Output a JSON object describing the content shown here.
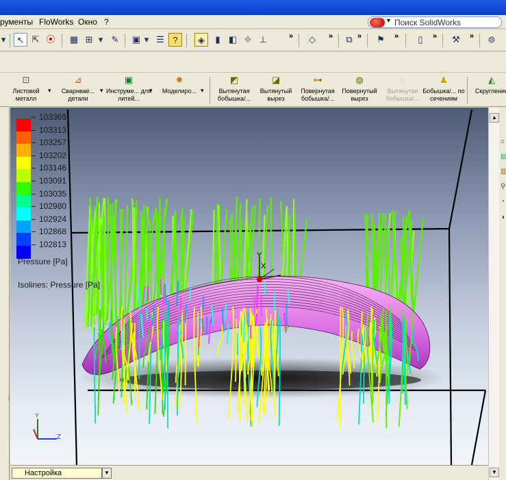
{
  "menu": {
    "items": [
      "рументы",
      "FloWorks",
      "Окно",
      "?"
    ]
  },
  "search": {
    "text": "Поиск SolidWorks"
  },
  "toolbar": {
    "more": "»"
  },
  "command_manager": {
    "groups": [
      {
        "label": "Листовой металл"
      },
      {
        "label": "Сварнвае... детали"
      },
      {
        "label": "Инструме... для литей..."
      },
      {
        "label": "Моделиро..."
      }
    ],
    "features": [
      {
        "label": "Вытянутая бобышка/...",
        "disabled": false
      },
      {
        "label": "Вытянутый вырез",
        "disabled": false
      },
      {
        "label": "Повернутая бобышка/...",
        "disabled": false
      },
      {
        "label": "Повернутый вырез",
        "disabled": false
      },
      {
        "label": "Вытянутая бобышка/...",
        "disabled": true
      },
      {
        "label": "Бобышка/... по сечениям",
        "disabled": false
      },
      {
        "label": "Скругление",
        "disabled": false
      }
    ]
  },
  "legend": {
    "values": [
      "103369",
      "103313",
      "103257",
      "103202",
      "103146",
      "103091",
      "103035",
      "102980",
      "102924",
      "102868",
      "102813"
    ],
    "colors": [
      "#ff0000",
      "#ff6000",
      "#ffb000",
      "#ffff00",
      "#b8ff00",
      "#30ff00",
      "#00ff90",
      "#00ffff",
      "#00a0ff",
      "#0040ff",
      "#0000ff"
    ],
    "title": "Pressure [Pa]",
    "isolines": "Isolines: Pressure [Pa]"
  },
  "triad": {
    "x": "X",
    "y": "Y",
    "z": "Z"
  },
  "status": {
    "configuration": "Настройка"
  }
}
